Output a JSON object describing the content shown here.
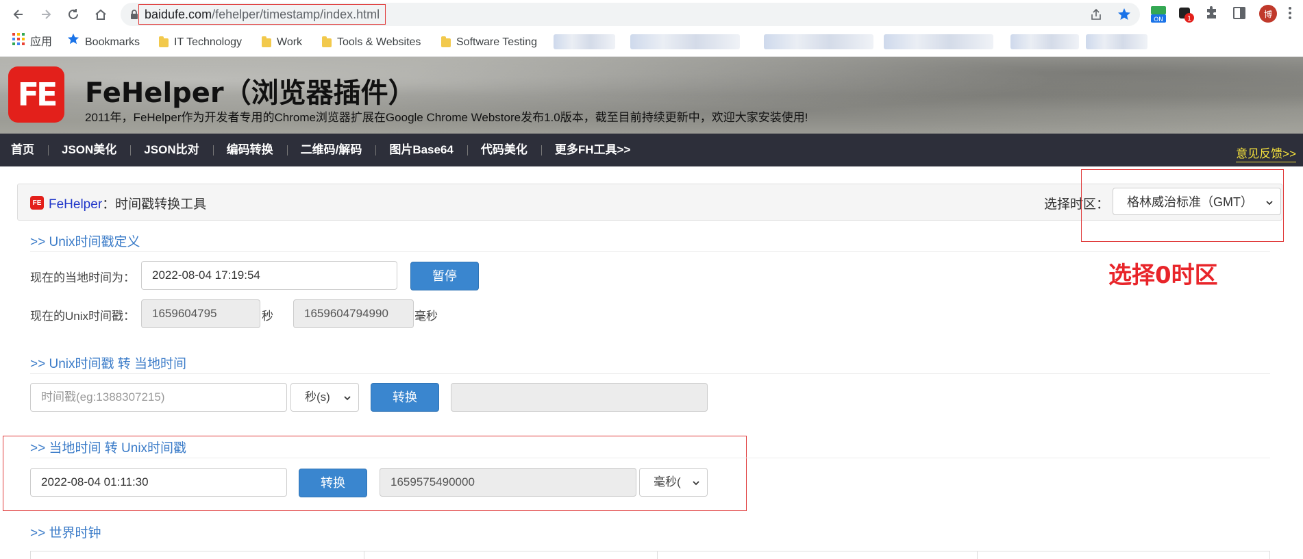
{
  "browser": {
    "url_host": "baidufe.com",
    "url_path": "/fehelper/timestamp/index.html",
    "ext_badge_on": "ON",
    "ext_badge_count": "1",
    "avatar_char": "博"
  },
  "bookmarks": {
    "apps_label": "应用",
    "items": [
      "Bookmarks",
      "IT Technology",
      "Work",
      "Tools & Websites",
      "Software Testing"
    ]
  },
  "site": {
    "logo_text": "FE",
    "title": "FeHelper（浏览器插件）",
    "subtitle": "2011年，FeHelper作为开发者专用的Chrome浏览器扩展在Google Chrome Webstore发布1.0版本，截至目前持续更新中，欢迎大家安装使用!",
    "menu": [
      "首页",
      "JSON美化",
      "JSON比对",
      "编码转换",
      "二维码/解码",
      "图片Base64",
      "代码美化",
      "更多FH工具>>"
    ],
    "feedback": "意见反馈>>"
  },
  "panel": {
    "brand": "FeHelper",
    "title_suffix": "：时间戳转换工具",
    "tz_label": "选择时区：",
    "tz_value": "格林威治标准（GMT）"
  },
  "unix_def": {
    "title": ">> Unix时间戳定义",
    "local_time_label": "现在的当地时间为：",
    "local_time_value": "2022-08-04 17:19:54",
    "pause_button": "暂停",
    "unix_label": "现在的Unix时间戳：",
    "unix_seconds": "1659604795",
    "seconds_unit": "秒",
    "unix_millis": "1659604794990",
    "millis_unit": "毫秒"
  },
  "unix_to_local": {
    "title": ">> Unix时间戳 转 当地时间",
    "input_placeholder": "时间戳(eg:1388307215)",
    "unit_select": "秒(s)",
    "convert_button": "转换",
    "result": ""
  },
  "local_to_unix": {
    "title": ">> 当地时间 转 Unix时间戳",
    "input_value": "2022-08-04 01:11:30",
    "convert_button": "转换",
    "result": "1659575490000",
    "unit_select": "毫秒("
  },
  "world_clock": {
    "title": ">> 世界时钟"
  },
  "annotation": {
    "text": "选择0时区",
    "color": "#e8252a"
  },
  "colors": {
    "menu_bg": "#2d2f3a",
    "accent": "#3a86cf",
    "section_title": "#3a7bc8",
    "annot": "#e03a3a"
  }
}
